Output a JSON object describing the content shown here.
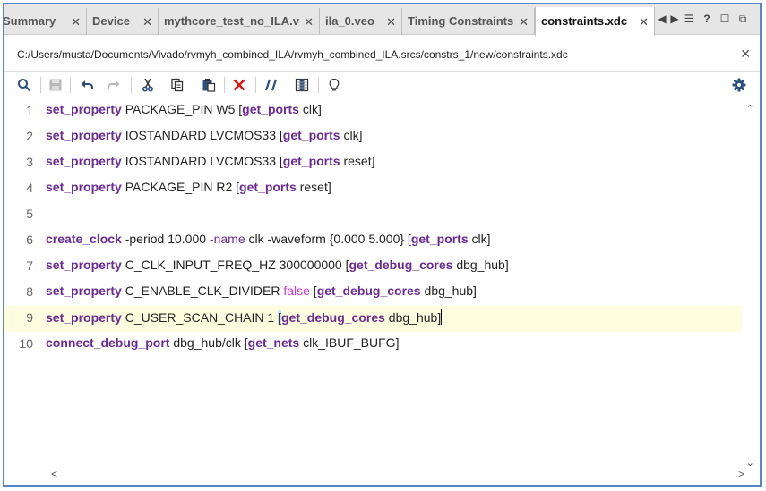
{
  "tabs": [
    {
      "label": "Summary",
      "active": false
    },
    {
      "label": "Device",
      "active": false
    },
    {
      "label": "mythcore_test_no_ILA.v",
      "active": false
    },
    {
      "label": "ila_0.veo",
      "active": false
    },
    {
      "label": "Timing Constraints",
      "active": false
    },
    {
      "label": "constraints.xdc",
      "active": true
    }
  ],
  "tab_controls": [
    "◀",
    "▶",
    "☰",
    "?",
    "☐",
    "⧉"
  ],
  "file_path": "C:/Users/musta/Documents/Vivado/rvmyh_combined_ILA/rvmyh_combined_ILA.srcs/constrs_1/new/constraints.xdc",
  "toolbar_icons": [
    "search-icon",
    "save-icon",
    "undo-icon",
    "redo-icon",
    "cut-icon",
    "copy-icon",
    "paste-icon",
    "delete-icon",
    "comment-icon",
    "column-select-icon",
    "lightbulb-icon",
    "gear-icon"
  ],
  "editor": {
    "current_line": 9,
    "lines": [
      {
        "num": "1",
        "cmd": "set_property",
        "a": " PACKAGE_PIN W5 [",
        "sub": "get_ports",
        "b": " clk]"
      },
      {
        "num": "2",
        "cmd": "set_property",
        "a": " IOSTANDARD LVCMOS33 [",
        "sub": "get_ports",
        "b": " clk]"
      },
      {
        "num": "3",
        "cmd": "set_property",
        "a": " IOSTANDARD LVCMOS33 [",
        "sub": "get_ports",
        "b": " reset]"
      },
      {
        "num": "4",
        "cmd": "set_property",
        "a": " PACKAGE_PIN R2 [",
        "sub": "get_ports",
        "b": " reset]"
      },
      {
        "num": "5"
      },
      {
        "num": "6",
        "cmd": "create_clock",
        "a": " -period 10.000 ",
        "opt": "-name",
        "a2": " clk -waveform {0.000 5.000} [",
        "sub": "get_ports",
        "b": " clk]"
      },
      {
        "num": "7",
        "cmd": "set_property",
        "a": " C_CLK_INPUT_FREQ_HZ 300000000 [",
        "sub": "get_debug_cores",
        "b": " dbg_hub]"
      },
      {
        "num": "8",
        "cmd": "set_property",
        "a": " C_ENABLE_CLK_DIVIDER ",
        "bool": "false",
        "a2": " [",
        "sub": "get_debug_cores",
        "b": " dbg_hub]"
      },
      {
        "num": "9",
        "cmd": "set_property",
        "a": " C_USER_SCAN_CHAIN 1 ",
        "bracket": "[",
        "sub": "get_debug_cores",
        "b": " dbg_hub]"
      },
      {
        "num": "10",
        "cmd": "connect_debug_port",
        "a": " dbg_hub/clk [",
        "sub": "get_nets",
        "b": " clk_IBUF_BUFG]"
      }
    ]
  },
  "colors": {
    "frame_border": "#5b84c4",
    "keyword": "#6b2c91",
    "boolean": "#d03bd0",
    "current_line": "#fffde0",
    "delete_red": "#d11a1a",
    "toolbar_blue": "#2c4f7c"
  }
}
